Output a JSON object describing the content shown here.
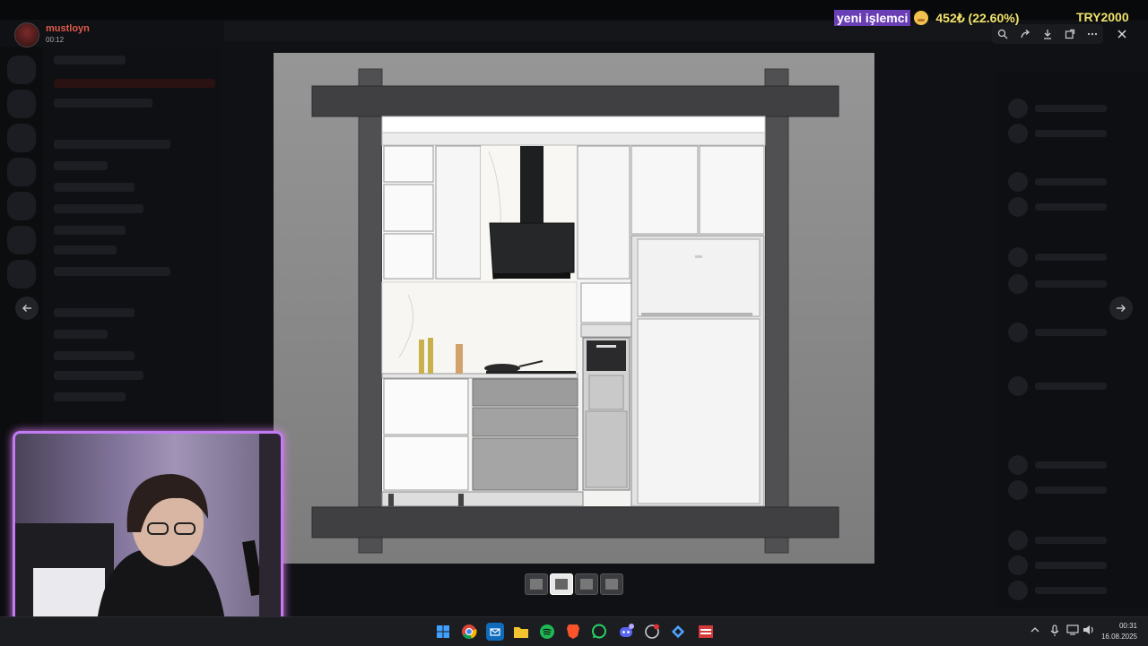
{
  "viewer": {
    "user_name": "mustloyn",
    "timestamp": "00:12",
    "toolbar_icons": [
      "zoom-icon",
      "forward-icon",
      "download-icon",
      "open-external-icon",
      "more-icon"
    ]
  },
  "overlay": {
    "label": "yeni işlemci",
    "value": "452₺ (22.60%)",
    "code": "TRY2000"
  },
  "taskbar": {
    "time": "00:31",
    "date": "16.08.2025"
  },
  "colors": {
    "webcam_border": "#c37bf3",
    "overlay_label_bg": "#6a3fb5",
    "overlay_text": "#f0e26a"
  }
}
